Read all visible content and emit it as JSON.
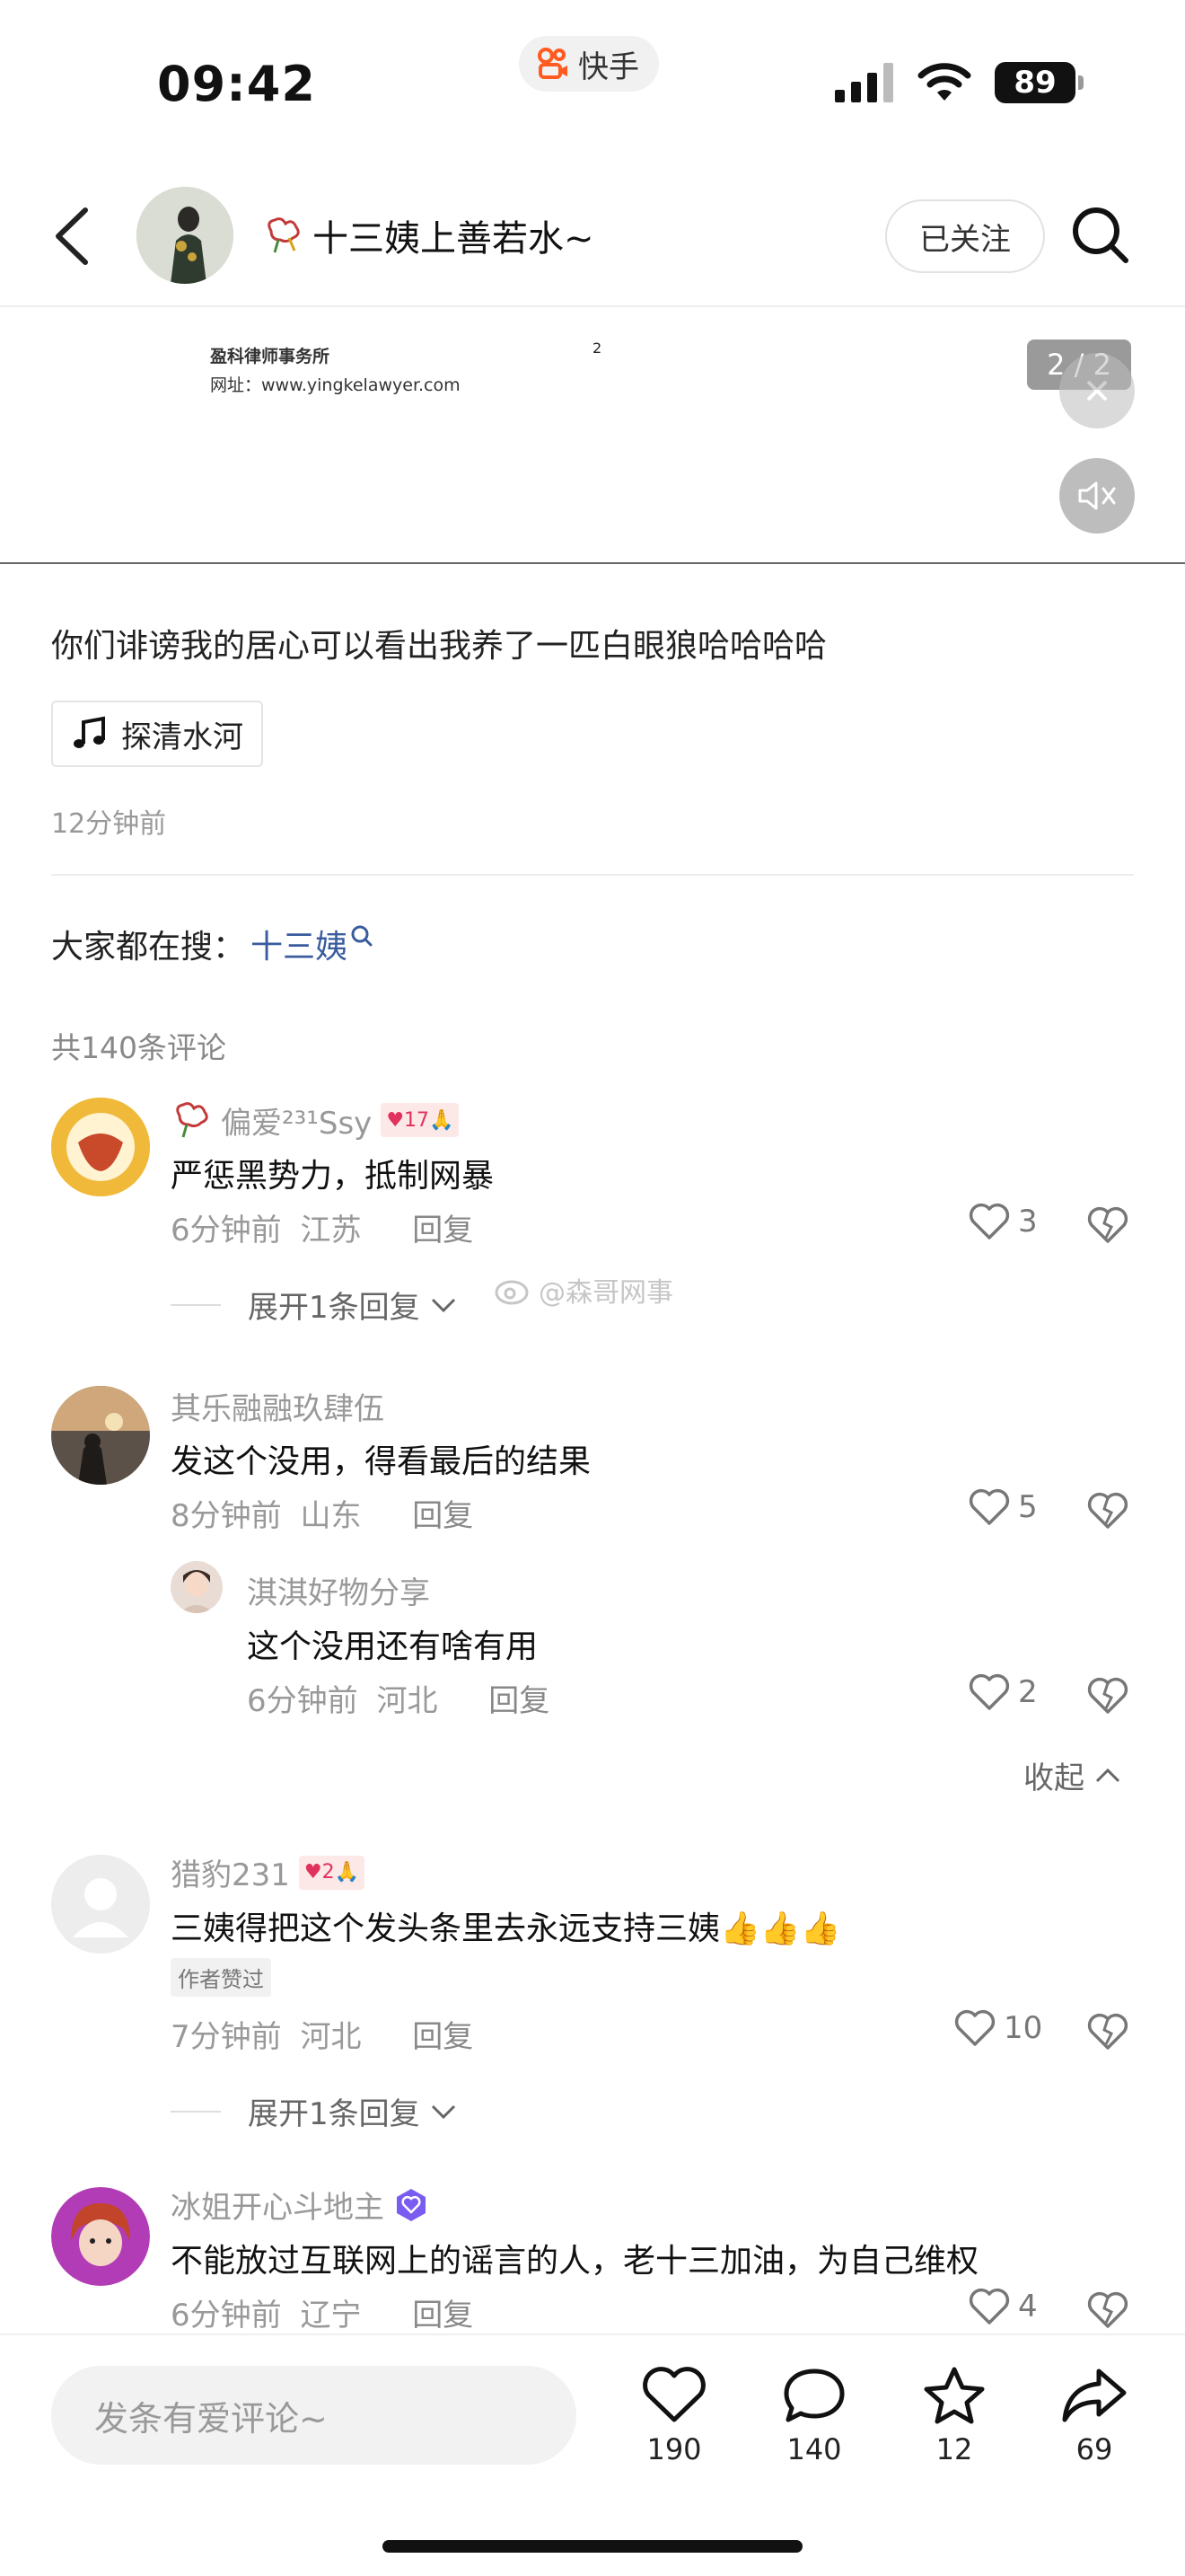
{
  "status_bar": {
    "time": "09:42",
    "app_name": "快手",
    "battery": "89"
  },
  "header": {
    "author_name": "十三姨上善若水~",
    "follow_label": "已关注",
    "icons": [
      "back-icon",
      "search-icon"
    ]
  },
  "media": {
    "firm_name": "盈科律师事务所",
    "website": "网址：www.yingkelawyer.com",
    "page_number": "2",
    "page_indicator": "2 / 2"
  },
  "post": {
    "caption": "你们诽谤我的居心可以看出我养了一匹白眼狼哈哈哈哈",
    "music": "探清水河",
    "posted_time": "12分钟前"
  },
  "search_hint": {
    "label": "大家都在搜：",
    "term": "十三姨"
  },
  "comments_header": "共140条评论",
  "watermark": "@森哥网事",
  "comments": [
    {
      "name": "偏爱²³¹Ssy",
      "badge": "17",
      "text": "严惩黑势力，抵制网暴",
      "time": "6分钟前",
      "location": "江苏",
      "reply": "回复",
      "likes": "3",
      "expand": "展开1条回复"
    },
    {
      "name": "其乐融融玖肆伍",
      "text": "发这个没用，得看最后的结果",
      "time": "8分钟前",
      "location": "山东",
      "reply": "回复",
      "likes": "5",
      "sub_reply": {
        "name": "淇淇好物分享",
        "text": "这个没用还有啥有用",
        "time": "6分钟前",
        "location": "河北",
        "reply": "回复",
        "likes": "2"
      },
      "collapse": "收起"
    },
    {
      "name": "猎豹231",
      "badge": "2",
      "text": "三姨得把这个发头条里去永远支持三姨👍👍👍",
      "author_liked": "作者赞过",
      "time": "7分钟前",
      "location": "河北",
      "reply": "回复",
      "likes": "10",
      "expand": "展开1条回复"
    },
    {
      "name": "冰姐开心斗地主",
      "text": "不能放过互联网上的谣言的人，老十三加油，为自己维权",
      "time": "6分钟前",
      "location": "辽宁",
      "reply": "回复",
      "likes": "4"
    }
  ],
  "bottom_bar": {
    "input_placeholder": "发条有爱评论~",
    "likes": "190",
    "comments": "140",
    "favorites": "12",
    "shares": "69"
  },
  "colors": {
    "link": "#3a5c9e",
    "brand": "#ff5a1f",
    "badge_pink": "#e0325c"
  }
}
